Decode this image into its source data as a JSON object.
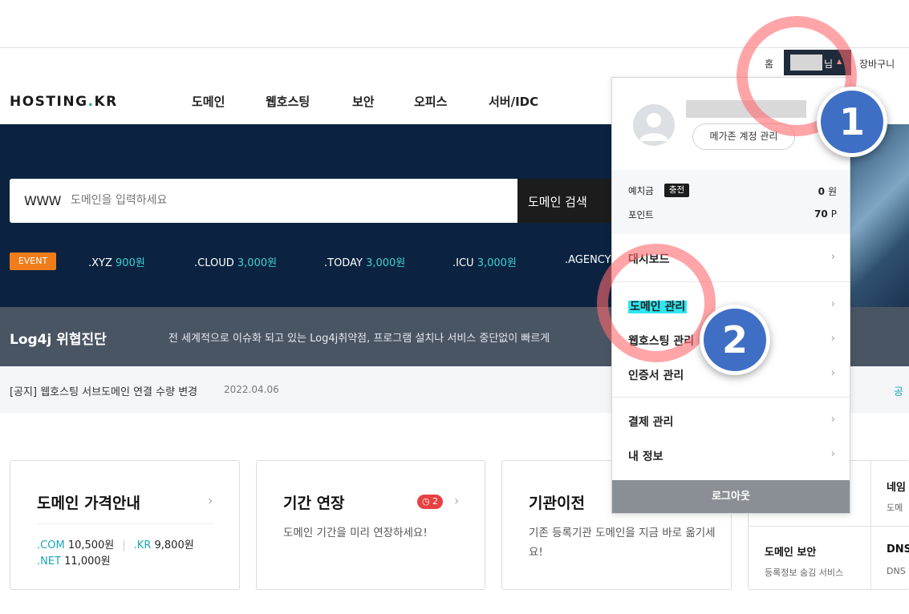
{
  "util": {
    "home": "홈",
    "user_suffix": "님",
    "user_arrow": "▲",
    "cart": "장바구니"
  },
  "logo": {
    "part1": "HOSTING",
    "dot": ".",
    "part2": "KR"
  },
  "nav": [
    "도메인",
    "웹호스팅",
    "보안",
    "오피스",
    "서버/IDC"
  ],
  "search": {
    "prefix": "WWW",
    "placeholder": "도메인을 입력하세요",
    "button": "도메인 검색"
  },
  "event": {
    "badge": "EVENT",
    "tlds": [
      {
        "name": ".XYZ",
        "price": "900원"
      },
      {
        "name": ".CLOUD",
        "price": "3,000원"
      },
      {
        "name": ".TODAY",
        "price": "3,000원"
      },
      {
        "name": ".ICU",
        "price": "3,000원"
      },
      {
        "name": ".AGENCY",
        "price": ""
      }
    ]
  },
  "log4j": {
    "title": "Log4j 위협진단",
    "desc": "전 세계적으로 이슈화 되고 있는 Log4j취약점, 프로그램 설치나 서비스 중단없이 빠르게"
  },
  "notice": {
    "text": "[공지] 웹호스팅 서브도메인 연결 수량 변경",
    "date": "2022.04.06",
    "right": "공"
  },
  "cards": {
    "price_guide": {
      "title": "도메인 가격안내",
      "com": ".COM",
      "com_price": "10,500원",
      "kr": ".KR",
      "kr_price": "9,800원",
      "net": ".NET",
      "net_price": "11,000원",
      "sep": "|"
    },
    "renewal": {
      "title": "기간 연장",
      "badge": "2",
      "desc": "도메인 기간을 미리 연장하세요!"
    },
    "transfer": {
      "title": "기관이전",
      "desc": "기존 등록기관 도메인을 지금 바로 옮기세요!"
    },
    "grid": {
      "top_left_sub": "!",
      "top_right": "네임",
      "top_right_sub": "도메",
      "security": "도메인 보안",
      "security_sub": "등록정보 숨김 서비스",
      "dns": "DNS",
      "dns_sub": "DNS"
    }
  },
  "dropdown": {
    "account_button": "메가존 계정 관리",
    "deposit_label": "예치금",
    "charge": "충전",
    "deposit_value": "0",
    "deposit_unit": "원",
    "point_label": "포인트",
    "point_value": "70",
    "point_unit": "P",
    "items": [
      {
        "label": "대시보드"
      },
      {
        "label": "도메인 관리"
      },
      {
        "label": "웹호스팅 관리"
      },
      {
        "label": "인증서 관리"
      },
      {
        "label": "결제 관리"
      },
      {
        "label": "내 정보"
      }
    ],
    "logout": "로그아웃"
  },
  "steps": [
    "1",
    "2"
  ],
  "icons": {
    "chevron": "chevron-right-icon",
    "clock": "clock-icon",
    "avatar": "user-avatar-icon"
  },
  "colors": {
    "hero": "#0b2340",
    "accent": "#19a7b8",
    "event": "#f07d1a",
    "callout": "#3f6fc4",
    "ring": "#ff696e",
    "highlight": "#2ee6f2"
  }
}
